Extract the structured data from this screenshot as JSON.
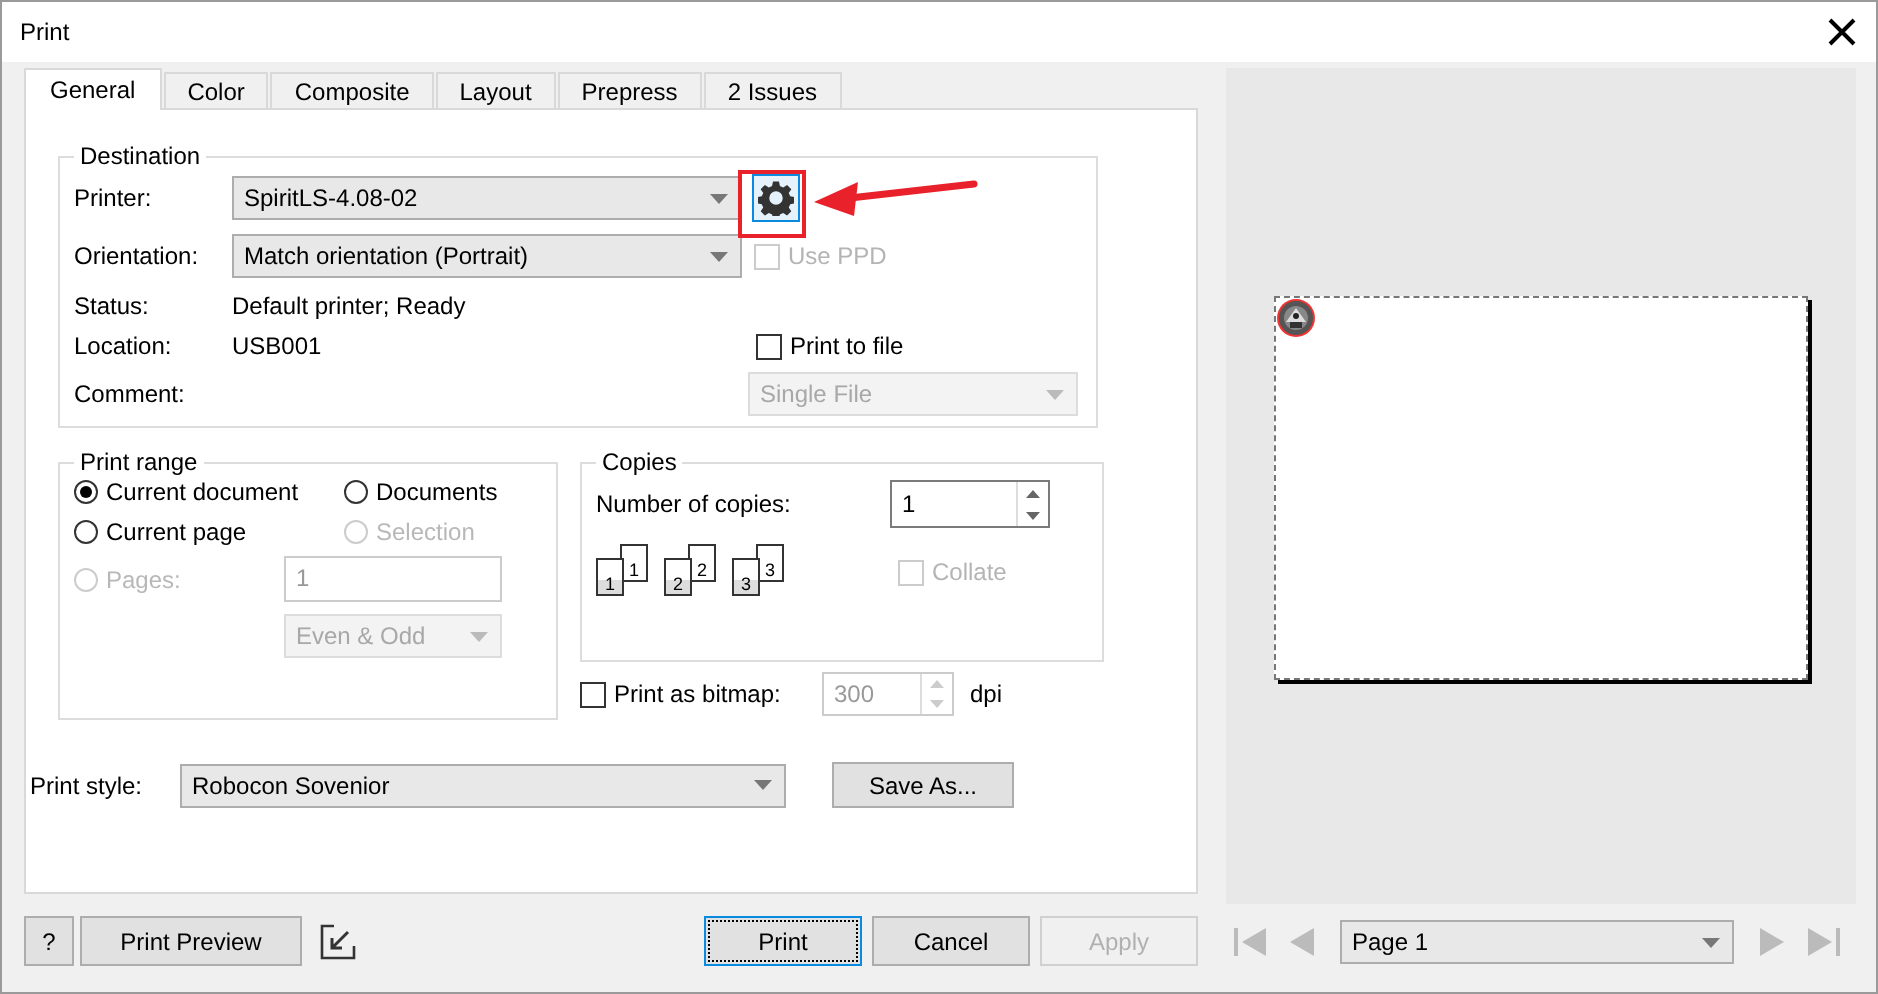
{
  "window": {
    "title": "Print"
  },
  "tabs": [
    {
      "label": "General",
      "selected": true
    },
    {
      "label": "Color",
      "selected": false
    },
    {
      "label": "Composite",
      "selected": false
    },
    {
      "label": "Layout",
      "selected": false
    },
    {
      "label": "Prepress",
      "selected": false
    },
    {
      "label": "2 Issues",
      "selected": false
    }
  ],
  "destination": {
    "title": "Destination",
    "printer": {
      "label": "Printer:",
      "value": "SpiritLS-4.08-02"
    },
    "orientation": {
      "label": "Orientation:",
      "value": "Match orientation (Portrait)"
    },
    "status": {
      "label": "Status:",
      "value": "Default printer; Ready"
    },
    "location": {
      "label": "Location:",
      "value": "USB001"
    },
    "comment": {
      "label": "Comment:"
    },
    "use_ppd": {
      "label": "Use PPD",
      "checked": false,
      "disabled": true
    },
    "print_to_file": {
      "label": "Print to file",
      "checked": false,
      "disabled": false
    },
    "file_mode": {
      "value": "Single File",
      "disabled": true
    }
  },
  "print_range": {
    "title": "Print range",
    "options": [
      {
        "label": "Current document",
        "selected": true,
        "disabled": false
      },
      {
        "label": "Documents",
        "selected": false,
        "disabled": false
      },
      {
        "label": "Current page",
        "selected": false,
        "disabled": false
      },
      {
        "label": "Selection",
        "selected": false,
        "disabled": true
      },
      {
        "label": "Pages:",
        "selected": false,
        "disabled": true
      }
    ],
    "pages": {
      "value": "1",
      "disabled": true
    },
    "page_filter": {
      "value": "Even & Odd",
      "disabled": true
    }
  },
  "copies": {
    "title": "Copies",
    "label": "Number of copies:",
    "value": "1",
    "collate_pages": [
      "1",
      "1",
      "2",
      "2",
      "3",
      "3"
    ],
    "collate": {
      "label": "Collate",
      "checked": false,
      "disabled": true
    }
  },
  "bitmap": {
    "label": "Print as bitmap:",
    "checked": false,
    "dpi": "300",
    "unit": "dpi"
  },
  "print_style": {
    "label": "Print style:",
    "value": "Robocon Sovenior",
    "save_as": "Save As..."
  },
  "buttons": [
    {
      "label": "?",
      "kind": "help",
      "disabled": false
    },
    {
      "label": "Print Preview",
      "kind": "preview",
      "disabled": false
    },
    {
      "label": "Print",
      "kind": "default",
      "disabled": false
    },
    {
      "label": "Cancel",
      "kind": "normal",
      "disabled": false
    },
    {
      "label": "Apply",
      "kind": "normal",
      "disabled": true
    }
  ],
  "preview": {
    "page": "Page 1"
  }
}
